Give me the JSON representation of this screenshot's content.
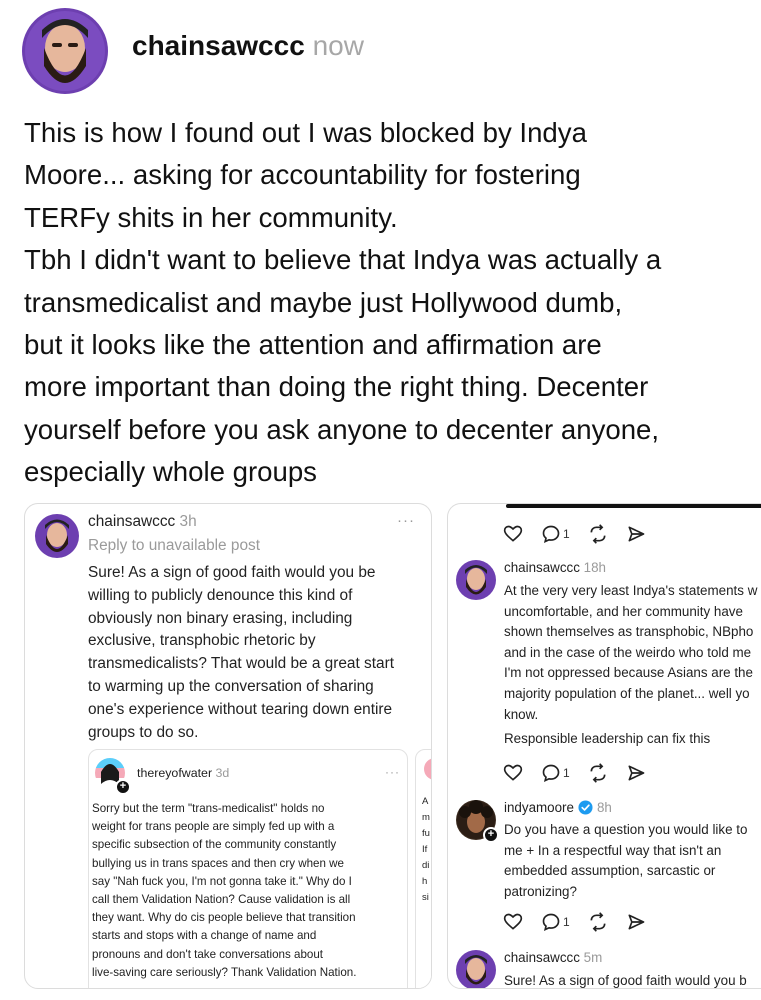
{
  "post": {
    "author": "chainsawccc",
    "time": "now",
    "lines": [
      "This is how I found out I was blocked by Indya",
      "Moore... asking for accountability for fostering",
      "TERFy shits in her community.",
      "Tbh I didn't want to believe that Indya was actually a",
      "transmedicalist and maybe just Hollywood dumb,",
      "but it looks like the attention and affirmation are",
      "more important than doing the right thing. Decenter",
      "yourself before you ask anyone to decenter anyone,",
      "especially whole groups"
    ]
  },
  "left_card": {
    "author": "chainsawccc",
    "time": "3h",
    "more": "···",
    "reply_note": "Reply to unavailable post",
    "lines": [
      "Sure! As a sign of good faith would you be",
      "willing to publicly denounce this kind of",
      "obviously non binary erasing, including",
      "exclusive, transphobic rhetoric by",
      "transmedicalists? That would be a great start",
      "to warming up the conversation of sharing",
      "one's experience without tearing down entire",
      "groups to do so."
    ],
    "quoted": {
      "author": "thereyofwater",
      "time": "3d",
      "more": "···",
      "badge": "+",
      "lines": [
        "Sorry but the term \"trans-medicalist\" holds no",
        "weight for trans people are simply fed up with a",
        "specific subsection of the community constantly",
        "bullying us in trans spaces and then cry when we",
        "say \"Nah fuck you, I'm not gonna take it.\" Why do I",
        "call them Validation Nation? Cause validation is all",
        "they want. Why do cis people believe that transition",
        "starts and stops with a change of name and",
        "pronouns and don't take conversations about",
        "live-saving care seriously? Thank Validation Nation."
      ]
    },
    "peek_lines": [
      "A",
      "m",
      "fu",
      "",
      "If",
      "di",
      "h",
      "si"
    ]
  },
  "right_card": {
    "actions": [
      {
        "icon": "heart-icon",
        "count": ""
      },
      {
        "icon": "comment-icon",
        "count": "1"
      },
      {
        "icon": "repost-icon",
        "count": ""
      },
      {
        "icon": "share-icon",
        "count": ""
      }
    ],
    "reply1": {
      "author": "chainsawccc",
      "time": "18h",
      "lines": [
        "At the very very least Indya's statements w",
        "uncomfortable,  and her community have",
        "shown themselves as transphobic, NBpho",
        "and in the case of the weirdo who told me",
        "I'm not oppressed because Asians are the",
        "majority population of the planet... well yo",
        "know."
      ],
      "extra": "Responsible leadership can fix this"
    },
    "reply2": {
      "author": "indyamoore",
      "time": "8h",
      "badge": "+",
      "lines": [
        "Do you have a question you would like to",
        "me + In a respectful way that isn't an",
        "embedded assumption, sarcastic or",
        "patronizing?"
      ]
    },
    "reply3": {
      "author": "chainsawccc",
      "time": "5m",
      "line": "Sure! As a sign of good faith would you b"
    },
    "verified_color": "#1d9bf0"
  }
}
